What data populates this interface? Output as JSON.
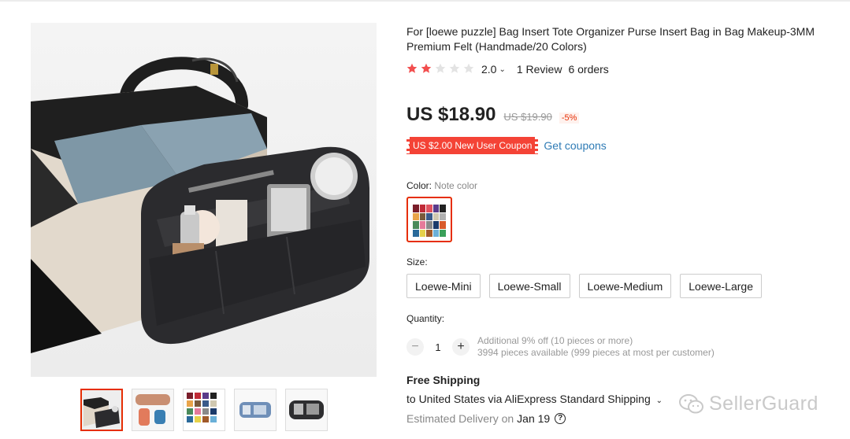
{
  "product": {
    "title": "For [loewe puzzle] Bag Insert Tote Organizer Purse Insert Bag in Bag Makeup-3MM Premium Felt (Handmade/20 Colors)",
    "rating": {
      "stars_filled": 2,
      "stars_total": 5,
      "value": "2.0",
      "reviews": "1 Review",
      "orders": "6 orders"
    },
    "price": {
      "current": "US $18.90",
      "original": "US $19.90",
      "discount": "-5%"
    },
    "coupon": {
      "label": "US $2.00 New User Coupon",
      "link": "Get coupons"
    },
    "color": {
      "label": "Color:",
      "value": "Note color"
    },
    "size": {
      "label": "Size:",
      "options": [
        "Loewe-Mini",
        "Loewe-Small",
        "Loewe-Medium",
        "Loewe-Large"
      ]
    },
    "quantity": {
      "label": "Quantity:",
      "value": "1",
      "minus": "−",
      "plus": "+",
      "info_line1": "Additional 9% off (10 pieces or more)",
      "info_line2": "3994 pieces available (999 pieces at most per customer)"
    },
    "shipping": {
      "title": "Free Shipping",
      "line": "to United States via AliExpress Standard Shipping",
      "delivery_label": "Estimated Delivery on",
      "delivery_date": "Jan 19",
      "help": "?"
    }
  },
  "gallery": {
    "thumbnail_count": 5,
    "active_index": 0
  },
  "watermark": "SellerGuard",
  "colors": {
    "accent": "#e62e04",
    "coupon": "#f44336",
    "link": "#2e7bb5",
    "star": "#f24e4e"
  },
  "icons": [
    "star-icon",
    "chevron-down-icon",
    "help-icon",
    "wechat-icon"
  ]
}
